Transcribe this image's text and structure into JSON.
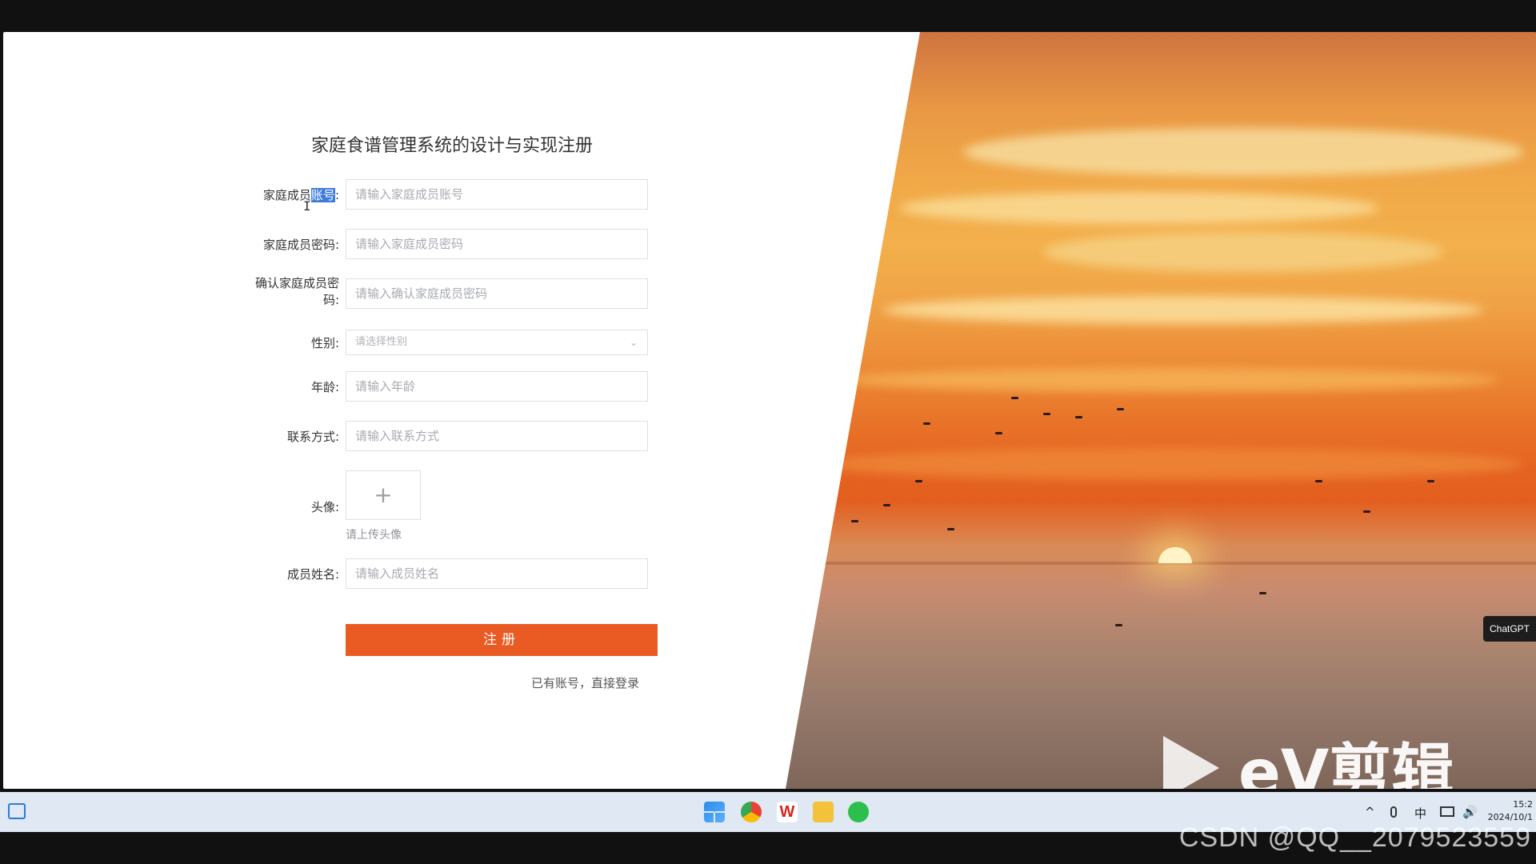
{
  "page": {
    "title": "家庭食谱管理系统的设计与实现注册"
  },
  "form": {
    "account": {
      "label_prefix": "家庭成员",
      "label_highlight": "账号",
      "label_suffix": ":",
      "placeholder": "请输入家庭成员账号"
    },
    "password": {
      "label": "家庭成员密码:",
      "placeholder": "请输入家庭成员密码"
    },
    "confirm_password": {
      "label_line1": "确认家庭成员密",
      "label_line2": "码:",
      "placeholder": "请输入确认家庭成员密码"
    },
    "gender": {
      "label": "性别:",
      "placeholder": "请选择性别"
    },
    "age": {
      "label": "年龄:",
      "placeholder": "请输入年龄"
    },
    "contact": {
      "label": "联系方式:",
      "placeholder": "请输入联系方式"
    },
    "avatar": {
      "label": "头像:",
      "plus": "+",
      "hint": "请上传头像"
    },
    "name": {
      "label": "成员姓名:",
      "placeholder": "请输入成员姓名"
    },
    "submit_label": "注册",
    "login_link": "已有账号，直接登录"
  },
  "overlay": {
    "chatgpt_tag": "ChatGPT",
    "ev_watermark": "eV剪辑",
    "csdn_watermark": "CSDN @QQ__2079523559"
  },
  "taskbar": {
    "icons": [
      "windows-start-icon",
      "chrome-icon",
      "wps-icon",
      "file-explorer-icon",
      "wechat-icon"
    ],
    "tray": {
      "chevron": "^",
      "ime": "中"
    },
    "time": "15:2",
    "date": "2024/10/1"
  },
  "colors": {
    "accent": "#ea5b23",
    "highlight": "#3d7bdc",
    "taskbar": "#dfe8f3"
  }
}
